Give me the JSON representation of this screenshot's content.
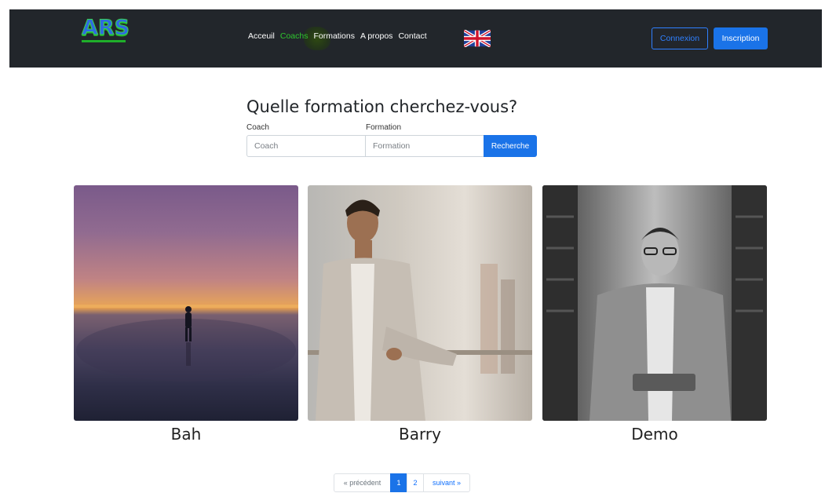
{
  "navbar": {
    "logo": "ARS",
    "links": [
      "Acceuil",
      "Coachs",
      "Formations",
      "A propos",
      "Contact"
    ],
    "active_link": "Coachs",
    "language_flag": "uk-flag-icon",
    "login_label": "Connexion",
    "signup_label": "Inscription"
  },
  "search": {
    "title": "Quelle formation cherchez-vous?",
    "coach_label": "Coach",
    "coach_placeholder": "Coach",
    "formation_label": "Formation",
    "formation_placeholder": "Formation",
    "button_label": "Recherche"
  },
  "coaches": [
    {
      "name": "Bah"
    },
    {
      "name": "Barry"
    },
    {
      "name": "Demo"
    }
  ],
  "pagination": {
    "prev_label": "« précédent",
    "pages": [
      "1",
      "2"
    ],
    "current_page": "1",
    "next_label": "suivant »"
  },
  "colors": {
    "navbar_bg": "#22262b",
    "accent": "#1a73e8",
    "active_link": "#2ec72e"
  }
}
